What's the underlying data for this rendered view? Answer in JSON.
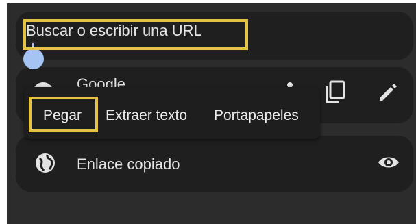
{
  "search": {
    "text": "Buscar o escribir una URL"
  },
  "suggestions": [
    {
      "label": "Google",
      "icon": "globe-icon"
    },
    {
      "label": "Enlace copiado",
      "icon": "globe-icon",
      "action_icon": "eye-icon"
    }
  ],
  "suggestion_actions": [
    {
      "icon": "copy-icon"
    },
    {
      "icon": "pencil-icon"
    }
  ],
  "context_menu": {
    "items": [
      {
        "label": "Pegar"
      },
      {
        "label": "Extraer texto"
      },
      {
        "label": "Portapapeles"
      }
    ]
  },
  "colors": {
    "highlight": "#e4c343",
    "background": "#2c2c2c",
    "card": "#1f1f1f",
    "text": "#e3e3e3",
    "cursor": "#a5c4f4"
  }
}
